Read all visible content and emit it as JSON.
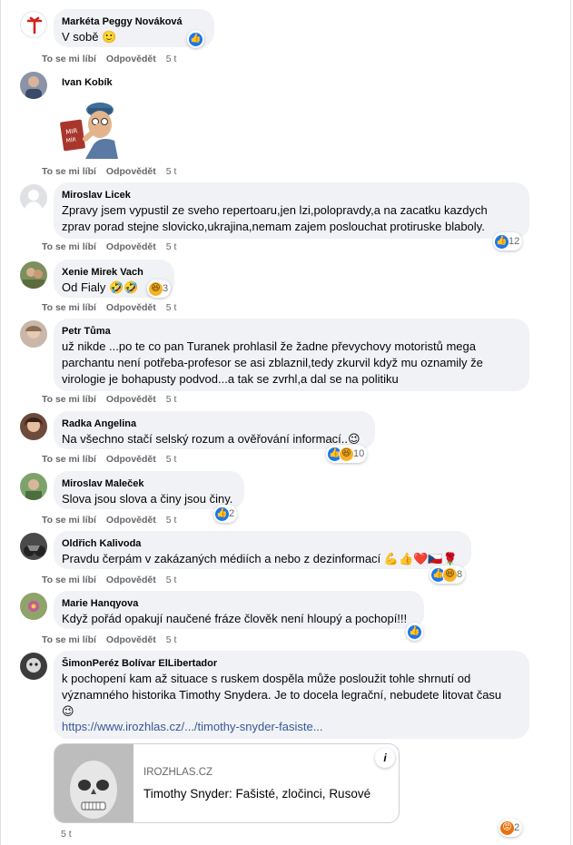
{
  "labels": {
    "like": "To se mi líbí",
    "reply": "Odpovědět"
  },
  "comments": [
    {
      "author": "Markéta Peggy Nováková",
      "lines": [
        "V sobě 🙂"
      ],
      "time": "5 t",
      "reactions": ""
    },
    {
      "author": "Ivan Kobík",
      "lines": [],
      "time": "5 t",
      "sticker": "thinking-man-sticker"
    },
    {
      "author": "Miroslav Licek",
      "lines": [
        "Zpravy jsem vypustil ze sveho repertoaru,jen lzi,polopravdy,a na zacatku kazdych",
        "zprav porad stejne slovicko,ukrajina,nemam zajem poslouchat protiruske blaboly."
      ],
      "time": "5 t",
      "reactions": "12"
    },
    {
      "author": "Xenie Mirek Vach",
      "lines": [
        "Od Fialy 🤣🤣"
      ],
      "time": "5 t",
      "reactions": "3"
    },
    {
      "author": "Petr Tůma",
      "lines": [
        "už nikde ...po te co pan Turanek prohlasil že žadne převychovy motoristů mega",
        "parchantu není potřeba-profesor se asi zblaznil,tedy zkurvil když mu oznamily že",
        "virologie je bohapusty podvod...a tak se zvrhl,a dal se na politiku"
      ],
      "time": "5 t",
      "reactions": ""
    },
    {
      "author": "Radka Angelina",
      "lines": [
        "Na všechno stačí selský rozum a ověřování informací..😉"
      ],
      "time": "5 t",
      "reactions": "10"
    },
    {
      "author": "Miroslav Maleček",
      "lines": [
        "Slova jsou slova a činy jsou činy."
      ],
      "time": "5 t",
      "reactions": "2"
    },
    {
      "author": "Oldřich Kalivoda",
      "lines": [
        "Pravdu čerpám v zakázaných médiích a nebo z dezinformací 💪👍❤️🇨🇿🌹"
      ],
      "time": "5 t",
      "reactions": "8"
    },
    {
      "author": "Marie Hanqyova",
      "lines": [
        "Když pořád opakují naučené fráze člověk není hloupý a pochopí!!!"
      ],
      "time": "5 t",
      "reactions": ""
    },
    {
      "author": "ŠimonPeréz Bolívar ElLibertador",
      "lines": [
        "k pochopení kam až situace s ruskem dospěla může posloužit tohle shrnutí od",
        "významného historika Timothy Snydera. Je to docela legrační, nebudete litovat času",
        "😉"
      ],
      "link": "https://www.irozhlas.cz/.../timothy-snyder-fasiste...",
      "time": "5 t",
      "reactions": "2"
    }
  ],
  "preview": {
    "domain": "IROZHLAS.CZ",
    "title": "Timothy Snyder: Fašisté, zločinci, Rusové",
    "info": "i"
  },
  "colors": {
    "like": "#1877f2",
    "bubble": "#f0f2f5",
    "meta": "#65676b",
    "link": "#385898"
  }
}
